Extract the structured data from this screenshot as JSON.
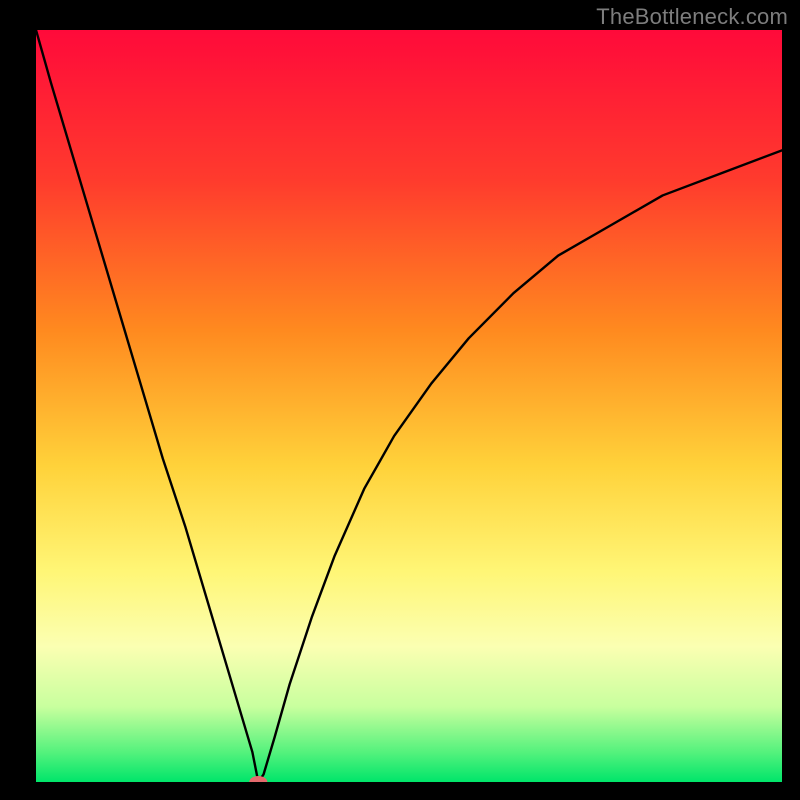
{
  "frame": {
    "outer_w": 800,
    "outer_h": 800,
    "margin_left": 36,
    "margin_right": 18,
    "margin_top": 30,
    "margin_bottom": 18,
    "bg": "#000000"
  },
  "watermark": {
    "text": "TheBottleneck.com"
  },
  "gradient_stops": [
    {
      "pct": 0,
      "color": "#ff0a3a"
    },
    {
      "pct": 20,
      "color": "#ff3b2d"
    },
    {
      "pct": 40,
      "color": "#ff8a1f"
    },
    {
      "pct": 58,
      "color": "#ffd23a"
    },
    {
      "pct": 72,
      "color": "#fff676"
    },
    {
      "pct": 82,
      "color": "#fbffb2"
    },
    {
      "pct": 90,
      "color": "#c8ff9e"
    },
    {
      "pct": 96,
      "color": "#55f27d"
    },
    {
      "pct": 100,
      "color": "#00e56a"
    }
  ],
  "chart_data": {
    "type": "line",
    "title": "",
    "xlabel": "",
    "ylabel": "",
    "xlim": [
      0,
      100
    ],
    "ylim": [
      0,
      100
    ],
    "grid": false,
    "note": "V-shaped bottleneck curve. x is normalized component score; y is bottleneck percent. Values read off gradient/spatial position, rounded to whole percent.",
    "series": [
      {
        "name": "bottleneck-curve",
        "stroke": "#000000",
        "stroke_width": 2.4,
        "x": [
          0,
          2,
          5,
          8,
          11,
          14,
          17,
          20,
          23,
          26,
          29,
          29.8,
          30.5,
          32,
          34,
          37,
          40,
          44,
          48,
          53,
          58,
          64,
          70,
          77,
          84,
          92,
          100
        ],
        "y": [
          100,
          93,
          83,
          73,
          63,
          53,
          43,
          34,
          24,
          14,
          4,
          0,
          1,
          6,
          13,
          22,
          30,
          39,
          46,
          53,
          59,
          65,
          70,
          74,
          78,
          81,
          84
        ]
      }
    ],
    "markers": [
      {
        "name": "optimal-point",
        "x": 29.8,
        "y": 0,
        "rx": 9,
        "ry": 6,
        "fill": "#e46a6d"
      }
    ]
  }
}
